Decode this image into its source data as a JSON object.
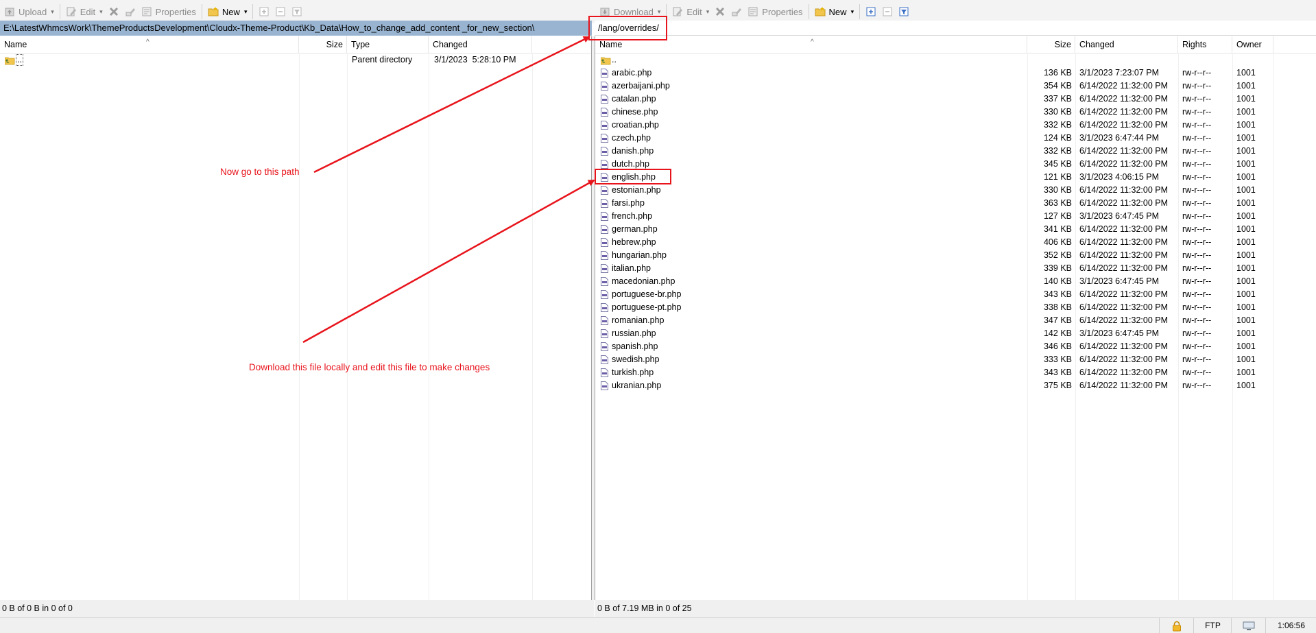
{
  "toolbar_left": {
    "upload": "Upload",
    "edit": "Edit",
    "properties": "Properties",
    "new": "New"
  },
  "toolbar_right": {
    "download": "Download",
    "edit": "Edit",
    "properties": "Properties",
    "new": "New"
  },
  "left_panel": {
    "path": "E:\\LatestWhmcsWork\\ThemeProductsDevelopment\\Cloudx-Theme-Product\\Kb_Data\\How_to_change_add_content _for_new_section\\",
    "columns": {
      "name": "Name",
      "size": "Size",
      "type": "Type",
      "changed": "Changed"
    },
    "rows": [
      {
        "name": "..",
        "size": "",
        "type": "Parent directory",
        "changed": "3/1/2023  5:28:10 PM"
      }
    ],
    "status": "0 B of 0 B in 0 of 0"
  },
  "right_panel": {
    "path": "/lang/overrides/",
    "columns": {
      "name": "Name",
      "size": "Size",
      "changed": "Changed",
      "rights": "Rights",
      "owner": "Owner"
    },
    "parent": "..",
    "rows": [
      {
        "name": "arabic.php",
        "size": "136 KB",
        "changed": "3/1/2023 7:23:07 PM",
        "rights": "rw-r--r--",
        "owner": "1001"
      },
      {
        "name": "azerbaijani.php",
        "size": "354 KB",
        "changed": "6/14/2022 11:32:00 PM",
        "rights": "rw-r--r--",
        "owner": "1001"
      },
      {
        "name": "catalan.php",
        "size": "337 KB",
        "changed": "6/14/2022 11:32:00 PM",
        "rights": "rw-r--r--",
        "owner": "1001"
      },
      {
        "name": "chinese.php",
        "size": "330 KB",
        "changed": "6/14/2022 11:32:00 PM",
        "rights": "rw-r--r--",
        "owner": "1001"
      },
      {
        "name": "croatian.php",
        "size": "332 KB",
        "changed": "6/14/2022 11:32:00 PM",
        "rights": "rw-r--r--",
        "owner": "1001"
      },
      {
        "name": "czech.php",
        "size": "124 KB",
        "changed": "3/1/2023 6:47:44 PM",
        "rights": "rw-r--r--",
        "owner": "1001"
      },
      {
        "name": "danish.php",
        "size": "332 KB",
        "changed": "6/14/2022 11:32:00 PM",
        "rights": "rw-r--r--",
        "owner": "1001"
      },
      {
        "name": "dutch.php",
        "size": "345 KB",
        "changed": "6/14/2022 11:32:00 PM",
        "rights": "rw-r--r--",
        "owner": "1001"
      },
      {
        "name": "english.php",
        "size": "121 KB",
        "changed": "3/1/2023 4:06:15 PM",
        "rights": "rw-r--r--",
        "owner": "1001"
      },
      {
        "name": "estonian.php",
        "size": "330 KB",
        "changed": "6/14/2022 11:32:00 PM",
        "rights": "rw-r--r--",
        "owner": "1001"
      },
      {
        "name": "farsi.php",
        "size": "363 KB",
        "changed": "6/14/2022 11:32:00 PM",
        "rights": "rw-r--r--",
        "owner": "1001"
      },
      {
        "name": "french.php",
        "size": "127 KB",
        "changed": "3/1/2023 6:47:45 PM",
        "rights": "rw-r--r--",
        "owner": "1001"
      },
      {
        "name": "german.php",
        "size": "341 KB",
        "changed": "6/14/2022 11:32:00 PM",
        "rights": "rw-r--r--",
        "owner": "1001"
      },
      {
        "name": "hebrew.php",
        "size": "406 KB",
        "changed": "6/14/2022 11:32:00 PM",
        "rights": "rw-r--r--",
        "owner": "1001"
      },
      {
        "name": "hungarian.php",
        "size": "352 KB",
        "changed": "6/14/2022 11:32:00 PM",
        "rights": "rw-r--r--",
        "owner": "1001"
      },
      {
        "name": "italian.php",
        "size": "339 KB",
        "changed": "6/14/2022 11:32:00 PM",
        "rights": "rw-r--r--",
        "owner": "1001"
      },
      {
        "name": "macedonian.php",
        "size": "140 KB",
        "changed": "3/1/2023 6:47:45 PM",
        "rights": "rw-r--r--",
        "owner": "1001"
      },
      {
        "name": "portuguese-br.php",
        "size": "343 KB",
        "changed": "6/14/2022 11:32:00 PM",
        "rights": "rw-r--r--",
        "owner": "1001"
      },
      {
        "name": "portuguese-pt.php",
        "size": "338 KB",
        "changed": "6/14/2022 11:32:00 PM",
        "rights": "rw-r--r--",
        "owner": "1001"
      },
      {
        "name": "romanian.php",
        "size": "347 KB",
        "changed": "6/14/2022 11:32:00 PM",
        "rights": "rw-r--r--",
        "owner": "1001"
      },
      {
        "name": "russian.php",
        "size": "142 KB",
        "changed": "3/1/2023 6:47:45 PM",
        "rights": "rw-r--r--",
        "owner": "1001"
      },
      {
        "name": "spanish.php",
        "size": "346 KB",
        "changed": "6/14/2022 11:32:00 PM",
        "rights": "rw-r--r--",
        "owner": "1001"
      },
      {
        "name": "swedish.php",
        "size": "333 KB",
        "changed": "6/14/2022 11:32:00 PM",
        "rights": "rw-r--r--",
        "owner": "1001"
      },
      {
        "name": "turkish.php",
        "size": "343 KB",
        "changed": "6/14/2022 11:32:00 PM",
        "rights": "rw-r--r--",
        "owner": "1001"
      },
      {
        "name": "ukranian.php",
        "size": "375 KB",
        "changed": "6/14/2022 11:32:00 PM",
        "rights": "rw-r--r--",
        "owner": "1001"
      }
    ],
    "status": "0 B of 7.19 MB in 0 of 25"
  },
  "bottom_bar": {
    "protocol": "FTP",
    "elapsed": "1:06:56"
  },
  "annotations": {
    "path_note": "Now go to this path",
    "file_note": "Download this file locally and edit this file to make changes",
    "color": "#e8141c"
  },
  "icons": [
    "upload-icon",
    "edit-icon",
    "delete-icon",
    "rename-icon",
    "properties-icon",
    "new-folder-icon",
    "plus-icon",
    "minus-icon",
    "filter-icon",
    "download-icon",
    "parent-folder-icon",
    "php-file-icon",
    "lock-icon",
    "computer-icon"
  ]
}
